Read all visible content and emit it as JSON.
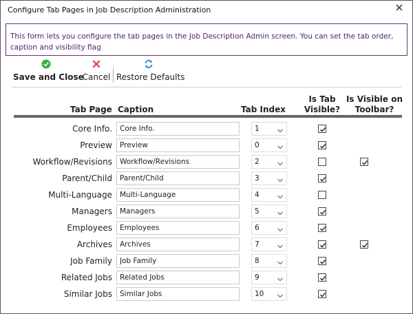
{
  "window": {
    "title": "Configure Tab Pages in Job Description Administration"
  },
  "info": {
    "text": "This form lets you configure the tab pages in the Job Description Admin screen. You can set the tab order, caption and visibility flag"
  },
  "toolbar": {
    "save_label": "Save and Close",
    "cancel_label": "Cancel",
    "restore_label": "Restore Defaults"
  },
  "columns": {
    "tab_page": "Tab Page",
    "caption": "Caption",
    "tab_index": "Tab Index",
    "is_tab_visible_1": "Is Tab",
    "is_tab_visible_2": "Visible?",
    "is_visible_toolbar_1": "Is Visible on",
    "is_visible_toolbar_2": "Toolbar?"
  },
  "colors": {
    "accent_border": "#6a2d7a",
    "info_text": "#4b1f6b",
    "save_icon": "#3fae3f",
    "cancel_icon": "#d9534f",
    "restore_icon": "#2a7fd4"
  },
  "icons": {
    "save": "check-circle-icon",
    "cancel": "x-icon",
    "restore": "refresh-icon",
    "close": "close-icon",
    "dropdown": "chevron-down-icon"
  },
  "rows": [
    {
      "tab_page": "Core Info.",
      "caption": "Core Info.",
      "index": "1",
      "tab_visible": true,
      "toolbar_visible": null
    },
    {
      "tab_page": "Preview",
      "caption": "Preview",
      "index": "0",
      "tab_visible": true,
      "toolbar_visible": null
    },
    {
      "tab_page": "Workflow/Revisions",
      "caption": "Workflow/Revisions",
      "index": "2",
      "tab_visible": false,
      "toolbar_visible": true
    },
    {
      "tab_page": "Parent/Child",
      "caption": "Parent/Child",
      "index": "3",
      "tab_visible": true,
      "toolbar_visible": null
    },
    {
      "tab_page": "Multi-Language",
      "caption": "Multi-Language",
      "index": "4",
      "tab_visible": false,
      "toolbar_visible": null
    },
    {
      "tab_page": "Managers",
      "caption": "Managers",
      "index": "5",
      "tab_visible": true,
      "toolbar_visible": null
    },
    {
      "tab_page": "Employees",
      "caption": "Employees",
      "index": "6",
      "tab_visible": true,
      "toolbar_visible": null
    },
    {
      "tab_page": "Archives",
      "caption": "Archives",
      "index": "7",
      "tab_visible": true,
      "toolbar_visible": true
    },
    {
      "tab_page": "Job Family",
      "caption": "Job Family",
      "index": "8",
      "tab_visible": true,
      "toolbar_visible": null
    },
    {
      "tab_page": "Related Jobs",
      "caption": "Related Jobs",
      "index": "9",
      "tab_visible": true,
      "toolbar_visible": null
    },
    {
      "tab_page": "Similar Jobs",
      "caption": "Similar Jobs",
      "index": "10",
      "tab_visible": true,
      "toolbar_visible": null
    }
  ]
}
